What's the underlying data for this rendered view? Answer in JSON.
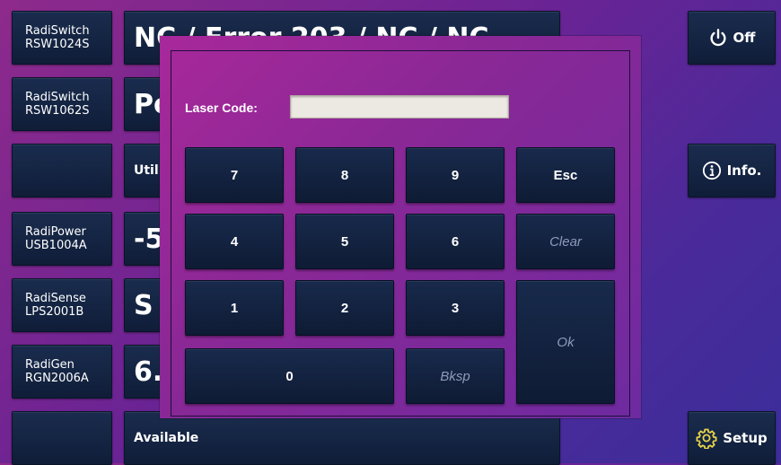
{
  "devices": [
    {
      "line1": "RadiSwitch",
      "line2": "RSW1024S"
    },
    {
      "line1": "RadiSwitch",
      "line2": "RSW1062S"
    },
    {
      "line1": "",
      "line2": ""
    },
    {
      "line1": "RadiPower",
      "line2": "USB1004A"
    },
    {
      "line1": "RadiSense",
      "line2": "LPS2001B"
    },
    {
      "line1": "RadiGen",
      "line2": "RGN2006A"
    },
    {
      "line1": "",
      "line2": ""
    }
  ],
  "rows": [
    "NC / Error 203 / NC / NC",
    "Po",
    "Util",
    "-5",
    "S",
    "6.",
    "Available"
  ],
  "side": {
    "off_label": "Off",
    "info_label": "Info.",
    "setup_label": "Setup"
  },
  "dialog": {
    "code_label": "Laser Code:",
    "code_value": "",
    "keys": {
      "k7": "7",
      "k8": "8",
      "k9": "9",
      "esc": "Esc",
      "k4": "4",
      "k5": "5",
      "k6": "6",
      "clear": "Clear",
      "k1": "1",
      "k2": "2",
      "k3": "3",
      "ok": "Ok",
      "k0": "0",
      "bksp": "Bksp"
    }
  },
  "icons": {
    "power": "power-icon",
    "info": "info-icon",
    "setup": "gear-icon"
  },
  "colors": {
    "tile": "#14264a",
    "dialog": "#8a2896",
    "background": "#6a2394"
  }
}
